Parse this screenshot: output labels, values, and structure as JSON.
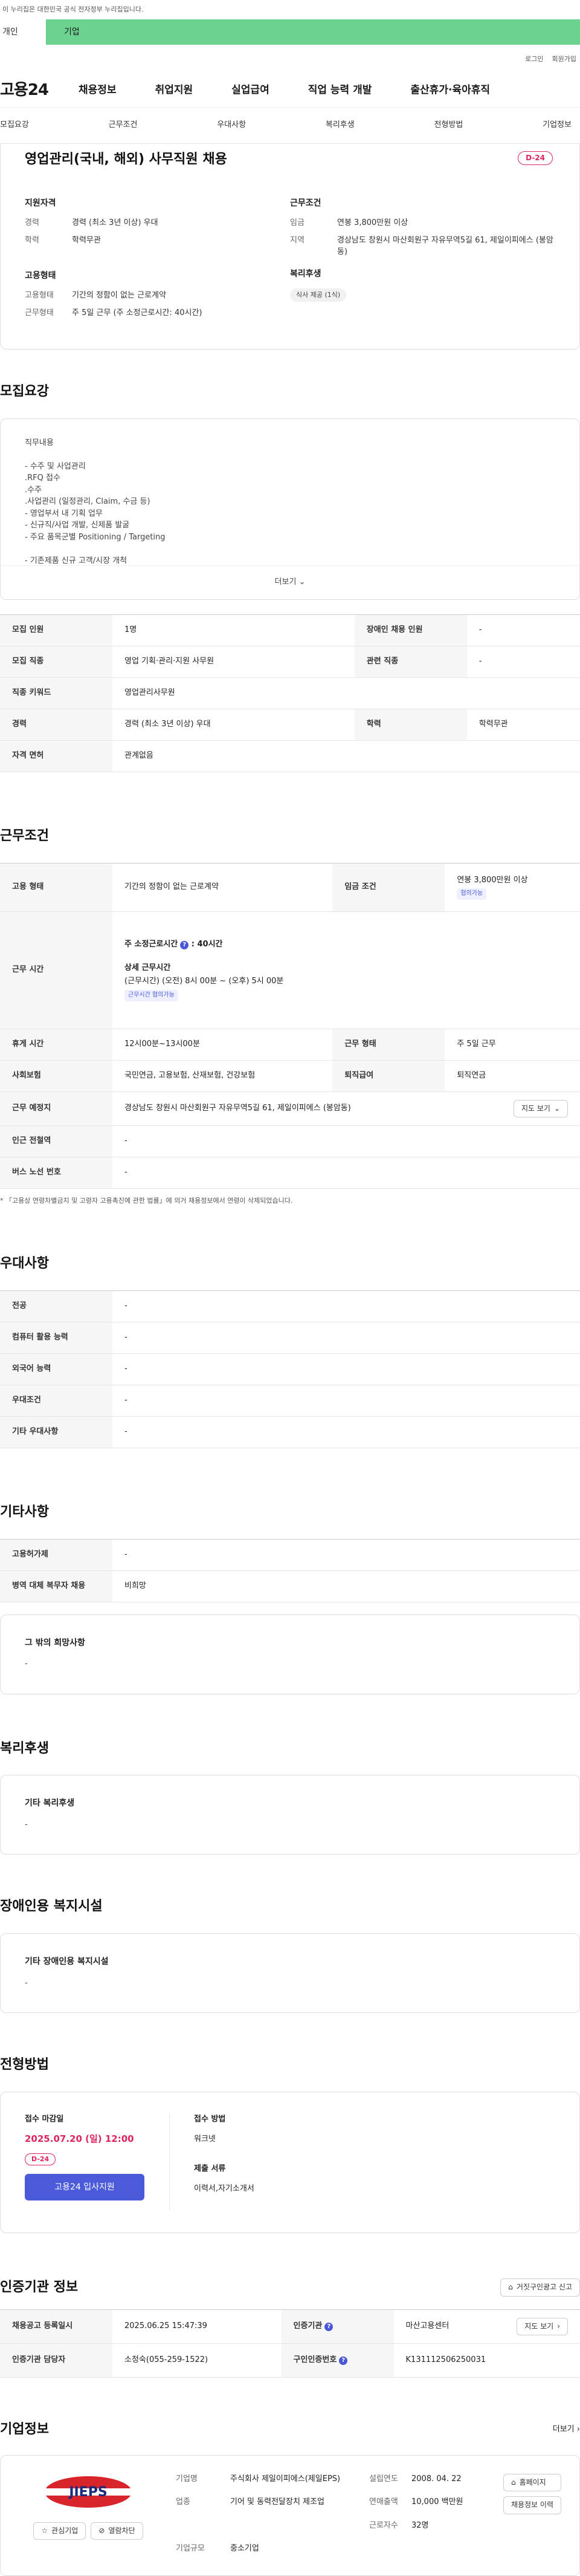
{
  "topbar": {
    "notice": "이 누리집은 대한민국 공식 전자정부 누리집입니다."
  },
  "tabs": {
    "personal": "개인",
    "corp": "기업"
  },
  "util": {
    "login": "로그인",
    "join": "회원가입"
  },
  "gnb": {
    "logo": "고용24",
    "items": [
      "채용정보",
      "취업지원",
      "실업급여",
      "직업 능력 개발",
      "출산휴가·육아휴직"
    ]
  },
  "anchor": [
    "모집요강",
    "근무조건",
    "우대사항",
    "복리후생",
    "전형방법",
    "기업정보"
  ],
  "job": {
    "title": "영업관리(국내, 해외) 사무직원 채용",
    "dday": "D-24",
    "qual_title": "지원자격",
    "qual": [
      {
        "k": "경력",
        "v": "경력 (최소 3년 이상) 우대"
      },
      {
        "k": "학력",
        "v": "학력무관"
      }
    ],
    "cond_title": "근무조건",
    "cond": [
      {
        "k": "임금",
        "v": "연봉 3,800만원 이상"
      },
      {
        "k": "지역",
        "v": "경상남도 창원시 마산회원구 자유무역5길 61, 제일이피에스 (봉암동)"
      }
    ],
    "emp_title": "고용형태",
    "emp": [
      {
        "k": "고용형태",
        "v": "기간의 정함이 없는 근로계약"
      },
      {
        "k": "근무형태",
        "v": "주 5일 근무 (주 소정근로시간: 40시간)"
      }
    ],
    "welfare_title": "복리후생",
    "welfare_chip": "식사 제공 (1식)"
  },
  "recruit": {
    "section": "모집요강",
    "desc": "직무내용\n\n- 수주 및 사업관리\n  .RFQ 접수\n  .수주\n  .사업관리 (일정관리, Claim, 수금 등)\n- 영업부서 내 기획 업무\n- 신규직/사업 개발, 신제품 발굴\n- 주요 품목군별 Positioning / Targeting\n\n- 기존제품 신규 고객/시장 개척",
    "more": "더보기",
    "rows": [
      {
        "k1": "모집 인원",
        "v1": "1명",
        "k2": "장애인 채용 인원",
        "v2": "-"
      },
      {
        "k1": "모집 직종",
        "v1": "영업 기획·관리·지원 사무원",
        "k2": "관련 직종",
        "v2": "-"
      },
      {
        "k1": "직종 키워드",
        "v1": "영업관리사무원"
      },
      {
        "k1": "경력",
        "v1": "경력 (최소 3년 이상) 우대",
        "k2": "학력",
        "v2": "학력무관"
      },
      {
        "k1": "자격 면허",
        "v1": "관계없음"
      }
    ]
  },
  "work": {
    "section": "근무조건",
    "emp_k": "고용 형태",
    "emp_v": "기간의 정함이 없는 근로계약",
    "wage_k": "임금 조건",
    "wage_v": "연봉 3,800만원 이상",
    "wage_tag": "협의가능",
    "time_k": "근무 시간",
    "weekly": "주 소정근로시간",
    "weekly_v": ": 40시간",
    "detail_t": "상세 근무시간",
    "detail_v": "(근무시간) (오전) 8시 00분 ~ (오후) 5시 00분",
    "time_tag": "근무시간 협의가능",
    "rows": [
      {
        "k1": "휴게 시간",
        "v1": "12시00분~13시00분",
        "k2": "근무 형태",
        "v2": "주 5일 근무"
      },
      {
        "k1": "사회보험",
        "v1": "국민연금, 고용보험, 산재보험, 건강보험",
        "k2": "퇴직급여",
        "v2": "퇴직연금"
      }
    ],
    "place_k": "근무 예정지",
    "place_v": "경상남도 창원시 마산회원구 자유무역5길 61, 제일이피에스 (봉암동)",
    "map": "지도 보기",
    "station_k": "인근 전철역",
    "station_v": "-",
    "bus_k": "버스 노선 번호",
    "bus_v": "-",
    "note": "* 「고용상 연령차별금지 및 고령자 고용촉진에 관한 법률」에 의거 채용정보에서 연령이 삭제되었습니다."
  },
  "pref": {
    "section": "우대사항",
    "rows": [
      {
        "k": "전공",
        "v": "-"
      },
      {
        "k": "컴퓨터 활용 능력",
        "v": "-"
      },
      {
        "k": "외국어 능력",
        "v": "-"
      },
      {
        "k": "우대조건",
        "v": "-"
      },
      {
        "k": "기타 우대사항",
        "v": "-"
      }
    ]
  },
  "etc": {
    "section": "기타사항",
    "rows": [
      {
        "k": "고용허가제",
        "v": "-"
      },
      {
        "k": "병역 대체 복무자 채용",
        "v": "비희망"
      }
    ],
    "box_t": "그 밖의 희망사항",
    "box_v": "-"
  },
  "benefit": {
    "section": "복리후생",
    "box_t": "기타 복리후생",
    "box_v": "-"
  },
  "disabled": {
    "section": "장애인용 복지시설",
    "box_t": "기타 장애인용 복지시설",
    "box_v": "-"
  },
  "selection": {
    "section": "전형방법",
    "deadline_t": "접수 마감일",
    "deadline_v": "2025.07.20 (일) 12:00",
    "dday": "D-24",
    "apply": "고용24 입사지원",
    "method_t": "접수 방법",
    "method_v": "워크넷",
    "docs_t": "제출 서류",
    "docs_v": "이력서,자기소개서"
  },
  "cert": {
    "section": "인증기관 정보",
    "report": "거짓구인광고 신고",
    "reg_k": "채용공고 등록일시",
    "reg_v": "2025.06.25 15:47:39",
    "org_k": "인증기관",
    "org_v": "마산고용센터",
    "map": "지도 보기",
    "mgr_k": "인증기관 담당자",
    "mgr_v": "소정숙(055-259-1522)",
    "no_k": "구인인증번호",
    "no_v": "K131112506250031"
  },
  "company": {
    "section": "기업정보",
    "more": "더보기",
    "logo_text": "JIEPS",
    "fav": "관심기업",
    "block": "열람차단",
    "name_k": "기업명",
    "name_v": "주식회사 제일이피에스(제일EPS)",
    "year_k": "설립연도",
    "year_v": "2008. 04. 22",
    "ind_k": "업종",
    "ind_v": "기어 및 동력전달장치 제조업",
    "sales_k": "연매출액",
    "sales_v": "10,000 백만원",
    "emp_k": "근로자수",
    "emp_v": "32명",
    "size_k": "기업규모",
    "size_v": "중소기업",
    "home": "홈페이지",
    "jobs": "채용정보 이력"
  },
  "colors": {
    "accent": "#4a5ad9",
    "green": "#6cd28f",
    "pink": "#e0245e"
  }
}
